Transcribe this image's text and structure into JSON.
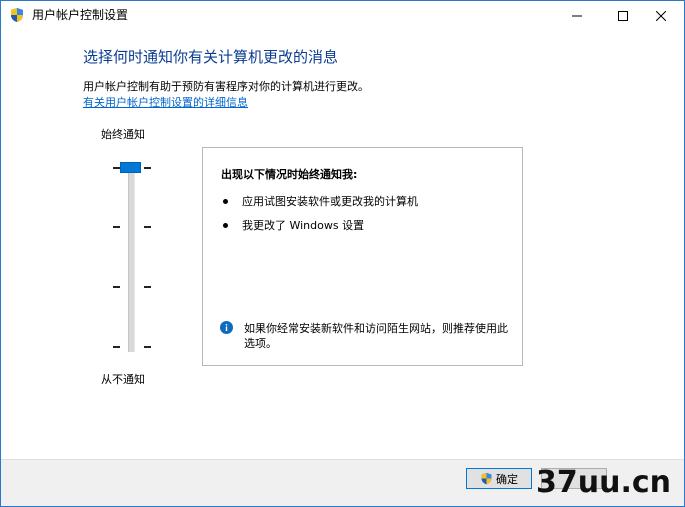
{
  "window": {
    "title": "用户帐户控制设置"
  },
  "main": {
    "heading": "选择何时通知你有关计算机更改的消息",
    "description": "用户帐户控制有助于预防有害程序对你的计算机进行更改。",
    "details_link": "有关用户帐户控制设置的详细信息"
  },
  "slider": {
    "top_label": "始终通知",
    "bottom_label": "从不通知",
    "level_count": 4,
    "selected_level": 4
  },
  "panel": {
    "title": "出现以下情况时始终通知我:",
    "bullets": [
      "应用试图安装软件或更改我的计算机",
      "我更改了 Windows 设置"
    ],
    "note": "如果你经常安装新软件和访问陌生网站，则推荐使用此选项。"
  },
  "footer": {
    "ok_label": "确定"
  },
  "watermark": {
    "text": "37uu.cn"
  },
  "colors": {
    "heading": "#0b3d91",
    "accent": "#0078d7",
    "link": "#0066cc"
  },
  "icons": {
    "title": "uac-shield-icon",
    "info": "info-icon",
    "ok": "uac-shield-icon"
  }
}
